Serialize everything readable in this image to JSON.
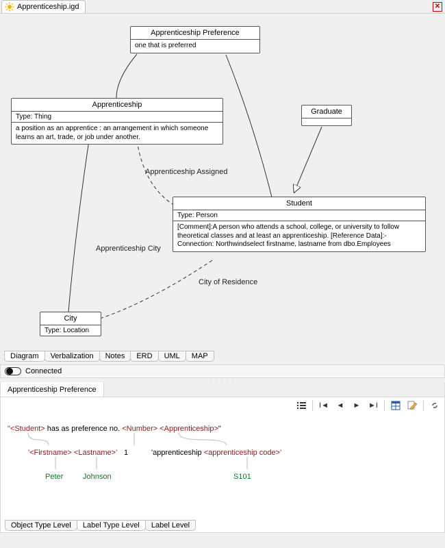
{
  "file_tab": {
    "label": "Apprenticeship.igd"
  },
  "nodes": {
    "pref": {
      "title": "Apprenticeship Preference",
      "desc": "one that is preferred"
    },
    "appr": {
      "title": "Apprenticeship",
      "type": "Type: Thing",
      "desc": "a position as an apprentice : an arrangement in which someone learns an art, trade, or job under another."
    },
    "grad": {
      "title": "Graduate"
    },
    "student": {
      "title": "Student",
      "type": "Type: Person",
      "desc": "[Comment]:A person who attends a school, college, or university to follow theoretical classes and at least an apprenticeship. [Reference Data]:- Connection: Northwindselect firstname, lastname from dbo.Employees"
    },
    "city": {
      "title": "City",
      "type": "Type: Location"
    }
  },
  "edge_labels": {
    "assigned": "Apprenticeship Assigned",
    "appr_city": "Apprenticeship City",
    "residence": "City of Residence"
  },
  "bottom_tabs": [
    "Diagram",
    "Verbalization",
    "Notes",
    "ERD",
    "UML",
    "MAP"
  ],
  "status": {
    "label": "Connected"
  },
  "lower_tab": "Apprenticeship Preference",
  "verbalization": {
    "line1": {
      "p1": "\"<Student>",
      "p2": " has as preference no. ",
      "p3": "<Number>",
      "p4": "<Apprenticeship>",
      "p5": "\""
    },
    "line2": {
      "p1": "'<Firstname>",
      "p2": "<Lastname>'",
      "num": "1",
      "p3": "'apprenticeship ",
      "p4": "<apprenticeship code>'"
    },
    "line3": {
      "first": "Peter",
      "last": "Johnson",
      "code": "S101"
    }
  },
  "footer_tabs": [
    "Object Type Level",
    "Label Type Level",
    "Label Level"
  ]
}
